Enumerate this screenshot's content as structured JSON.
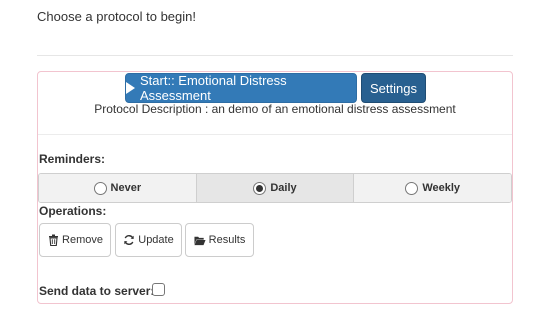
{
  "intro": "Choose a protocol to begin!",
  "protocol": {
    "start_label": "Start:: Emotional Distress Assessment",
    "settings_label": "Settings",
    "description": "Protocol Description : an demo of an emotional distress assessment"
  },
  "reminders": {
    "label": "Reminders:",
    "options": [
      "Never",
      "Daily",
      "Weekly"
    ],
    "selected": "Daily"
  },
  "operations": {
    "label": "Operations:",
    "remove_label": "Remove",
    "update_label": "Update",
    "results_label": "Results"
  },
  "send_data": {
    "label": "Send data to server:",
    "checked": false
  },
  "icons": {
    "start": "play-icon",
    "remove": "trash-icon",
    "update": "refresh-icon",
    "results": "folder-open-icon"
  },
  "colors": {
    "primary": "#337ab7",
    "primary_dark": "#286090",
    "panel_border": "#f2c4cf"
  }
}
